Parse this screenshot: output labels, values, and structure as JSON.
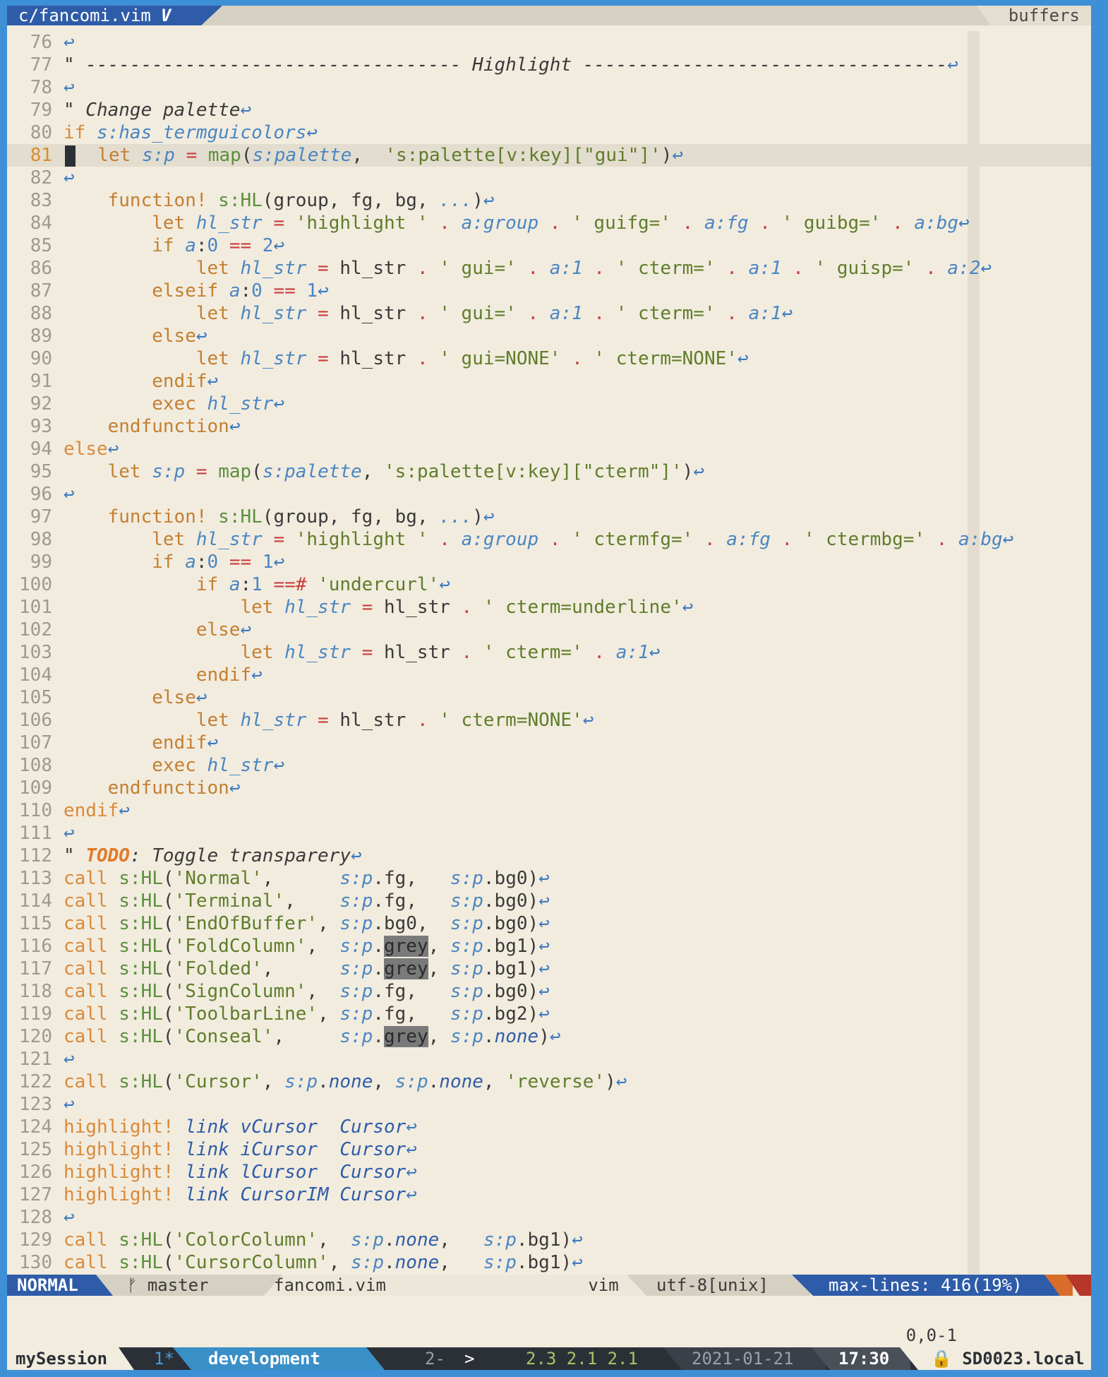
{
  "tabline": {
    "file_tab": "c/fancomi.vim",
    "file_tab_badge": "V",
    "buffers_label": "buffers"
  },
  "editor": {
    "lines": [
      {
        "n": "76",
        "h": "<span class='nl'>↩</span>"
      },
      {
        "n": "77",
        "h": "<span class='cm'>\" ---------------------------------- Highlight ---------------------------------</span><span class='nl'>↩</span>"
      },
      {
        "n": "78",
        "h": "<span class='nl'>↩</span>"
      },
      {
        "n": "79",
        "h": "<span class='cm'>\" Change palette</span><span class='nl'>↩</span>"
      },
      {
        "n": "80",
        "h": "<span class='kw'>if</span> <span class='var'>s:has_termguicolors</span><span class='nl'>↩</span>"
      },
      {
        "n": "81",
        "cur": true,
        "h": "<span class='cursorblk'></span>  <span class='kw2'>let</span> <span class='var'>s:p</span> <span class='op'>=</span> <span class='fn'>map</span>(<span class='var'>s:palette</span>,  <span class='str'>'s:palette[v:key][\"gui\"]'</span>)<span class='nl'>↩</span>"
      },
      {
        "n": "82",
        "h": "<span class='nl'>↩</span>"
      },
      {
        "n": "83",
        "h": "    <span class='kw2'>function!</span> <span class='fn'>s:HL</span>(group, fg, bg, <span class='var'>...</span>)<span class='nl'>↩</span>"
      },
      {
        "n": "84",
        "h": "        <span class='kw2'>let</span> <span class='var'>hl_str</span> <span class='op'>=</span> <span class='str'>'highlight '</span> <span class='op'>.</span> <span class='var'>a:group</span> <span class='op'>.</span> <span class='str'>' guifg='</span> <span class='op'>.</span> <span class='var'>a:fg</span> <span class='op'>.</span> <span class='str'>' guibg='</span> <span class='op'>.</span> <span class='var'>a:bg</span><span class='nl'>↩</span>"
      },
      {
        "n": "85",
        "h": "        <span class='kw2'>if</span> <span class='var'>a</span>:<span class='num'>0</span> <span class='op'>==</span> <span class='num'>2</span><span class='nl'>↩</span>"
      },
      {
        "n": "86",
        "h": "            <span class='kw2'>let</span> <span class='var'>hl_str</span> <span class='op'>=</span> hl_str <span class='op'>.</span> <span class='str'>' gui='</span> <span class='op'>.</span> <span class='var'>a:1</span> <span class='op'>.</span> <span class='str'>' cterm='</span> <span class='op'>.</span> <span class='var'>a:1</span> <span class='op'>.</span> <span class='str'>' guisp='</span> <span class='op'>.</span> <span class='var'>a:2</span><span class='nl'>↩</span>"
      },
      {
        "n": "87",
        "h": "        <span class='kw2'>elseif</span> <span class='var'>a</span>:<span class='num'>0</span> <span class='op'>==</span> <span class='num'>1</span><span class='nl'>↩</span>"
      },
      {
        "n": "88",
        "h": "            <span class='kw2'>let</span> <span class='var'>hl_str</span> <span class='op'>=</span> hl_str <span class='op'>.</span> <span class='str'>' gui='</span> <span class='op'>.</span> <span class='var'>a:1</span> <span class='op'>.</span> <span class='str'>' cterm='</span> <span class='op'>.</span> <span class='var'>a:1</span><span class='nl'>↩</span>"
      },
      {
        "n": "89",
        "h": "        <span class='kw2'>else</span><span class='nl'>↩</span>"
      },
      {
        "n": "90",
        "h": "            <span class='kw2'>let</span> <span class='var'>hl_str</span> <span class='op'>=</span> hl_str <span class='op'>.</span> <span class='str'>' gui=NONE'</span> <span class='op'>.</span> <span class='str'>' cterm=NONE'</span><span class='nl'>↩</span>"
      },
      {
        "n": "91",
        "h": "        <span class='kw2'>endif</span><span class='nl'>↩</span>"
      },
      {
        "n": "92",
        "h": "        <span class='kw2'>exec</span> <span class='var'>hl_str</span><span class='nl'>↩</span>"
      },
      {
        "n": "93",
        "h": "    <span class='kw2'>endfunction</span><span class='nl'>↩</span>"
      },
      {
        "n": "94",
        "h": "<span class='kw'>else</span><span class='nl'>↩</span>"
      },
      {
        "n": "95",
        "h": "    <span class='kw2'>let</span> <span class='var'>s:p</span> <span class='op'>=</span> <span class='fn'>map</span>(<span class='var'>s:palette</span>, <span class='str'>'s:palette[v:key][\"cterm\"]'</span>)<span class='nl'>↩</span>"
      },
      {
        "n": "96",
        "h": "<span class='nl'>↩</span>"
      },
      {
        "n": "97",
        "h": "    <span class='kw2'>function!</span> <span class='fn'>s:HL</span>(group, fg, bg, <span class='var'>...</span>)<span class='nl'>↩</span>"
      },
      {
        "n": "98",
        "h": "        <span class='kw2'>let</span> <span class='var'>hl_str</span> <span class='op'>=</span> <span class='str'>'highlight '</span> <span class='op'>.</span> <span class='var'>a:group</span> <span class='op'>.</span> <span class='str'>' ctermfg='</span> <span class='op'>.</span> <span class='var'>a:fg</span> <span class='op'>.</span> <span class='str'>' ctermbg='</span> <span class='op'>.</span> <span class='var'>a:bg</span><span class='nl'>↩</span>"
      },
      {
        "n": "99",
        "h": "        <span class='kw2'>if</span> <span class='var'>a</span>:<span class='num'>0</span> <span class='op'>==</span> <span class='num'>1</span><span class='nl'>↩</span>"
      },
      {
        "n": "100",
        "h": "            <span class='kw2'>if</span> <span class='var'>a</span>:<span class='num'>1</span> <span class='op'>==#</span> <span class='str'>'undercurl'</span><span class='nl'>↩</span>"
      },
      {
        "n": "101",
        "h": "                <span class='kw2'>let</span> <span class='var'>hl_str</span> <span class='op'>=</span> hl_str <span class='op'>.</span> <span class='str'>' cterm=underline'</span><span class='nl'>↩</span>"
      },
      {
        "n": "102",
        "h": "            <span class='kw2'>else</span><span class='nl'>↩</span>"
      },
      {
        "n": "103",
        "h": "                <span class='kw2'>let</span> <span class='var'>hl_str</span> <span class='op'>=</span> hl_str <span class='op'>.</span> <span class='str'>' cterm='</span> <span class='op'>.</span> <span class='var'>a:1</span><span class='nl'>↩</span>"
      },
      {
        "n": "104",
        "h": "            <span class='kw2'>endif</span><span class='nl'>↩</span>"
      },
      {
        "n": "105",
        "h": "        <span class='kw2'>else</span><span class='nl'>↩</span>"
      },
      {
        "n": "106",
        "h": "            <span class='kw2'>let</span> <span class='var'>hl_str</span> <span class='op'>=</span> hl_str <span class='op'>.</span> <span class='str'>' cterm=NONE'</span><span class='nl'>↩</span>"
      },
      {
        "n": "107",
        "h": "        <span class='kw2'>endif</span><span class='nl'>↩</span>"
      },
      {
        "n": "108",
        "h": "        <span class='kw2'>exec</span> <span class='var'>hl_str</span><span class='nl'>↩</span>"
      },
      {
        "n": "109",
        "h": "    <span class='kw2'>endfunction</span><span class='nl'>↩</span>"
      },
      {
        "n": "110",
        "h": "<span class='kw'>endif</span><span class='nl'>↩</span>"
      },
      {
        "n": "111",
        "h": "<span class='nl'>↩</span>"
      },
      {
        "n": "112",
        "h": "<span class='cm'>\" </span><span class='todo'>TODO</span><span class='cm'>: Toggle transparery</span><span class='nl'>↩</span>"
      },
      {
        "n": "113",
        "h": "<span class='kw'>call</span> <span class='fn'>s:HL</span>(<span class='str'>'Normal'</span>,      <span class='var'>s:p</span>.fg,   <span class='var'>s:p</span>.bg0)<span class='nl'>↩</span>"
      },
      {
        "n": "114",
        "h": "<span class='kw'>call</span> <span class='fn'>s:HL</span>(<span class='str'>'Terminal'</span>,    <span class='var'>s:p</span>.fg,   <span class='var'>s:p</span>.bg0)<span class='nl'>↩</span>"
      },
      {
        "n": "115",
        "h": "<span class='kw'>call</span> <span class='fn'>s:HL</span>(<span class='str'>'EndOfBuffer'</span>, <span class='var'>s:p</span>.bg0,  <span class='var'>s:p</span>.bg0)<span class='nl'>↩</span>"
      },
      {
        "n": "116",
        "h": "<span class='kw'>call</span> <span class='fn'>s:HL</span>(<span class='str'>'FoldColumn'</span>,  <span class='var'>s:p</span>.<span class='grey'>grey</span>, <span class='var'>s:p</span>.bg1)<span class='nl'>↩</span>"
      },
      {
        "n": "117",
        "h": "<span class='kw'>call</span> <span class='fn'>s:HL</span>(<span class='str'>'Folded'</span>,      <span class='var'>s:p</span>.<span class='grey'>grey</span>, <span class='var'>s:p</span>.bg1)<span class='nl'>↩</span>"
      },
      {
        "n": "118",
        "h": "<span class='kw'>call</span> <span class='fn'>s:HL</span>(<span class='str'>'SignColumn'</span>,  <span class='var'>s:p</span>.fg,   <span class='var'>s:p</span>.bg0)<span class='nl'>↩</span>"
      },
      {
        "n": "119",
        "h": "<span class='kw'>call</span> <span class='fn'>s:HL</span>(<span class='str'>'ToolbarLine'</span>, <span class='var'>s:p</span>.fg,   <span class='var'>s:p</span>.bg2)<span class='nl'>↩</span>"
      },
      {
        "n": "120",
        "h": "<span class='kw'>call</span> <span class='fn'>s:HL</span>(<span class='str'>'Conseal'</span>,     <span class='var'>s:p</span>.<span class='grey'>grey</span>, <span class='var'>s:p</span>.<span class='lnk'>none</span>)<span class='nl'>↩</span>"
      },
      {
        "n": "121",
        "h": "<span class='nl'>↩</span>"
      },
      {
        "n": "122",
        "h": "<span class='kw'>call</span> <span class='fn'>s:HL</span>(<span class='str'>'Cursor'</span>, <span class='var'>s:p</span>.<span class='lnk'>none</span>, <span class='var'>s:p</span>.<span class='lnk'>none</span>, <span class='str'>'reverse'</span>)<span class='nl'>↩</span>"
      },
      {
        "n": "123",
        "h": "<span class='nl'>↩</span>"
      },
      {
        "n": "124",
        "h": "<span class='kw'>highlight!</span> <span class='lnk'>link</span> <span class='lnk'>vCursor</span>  <span class='lnk'>Cursor</span><span class='nl'>↩</span>"
      },
      {
        "n": "125",
        "h": "<span class='kw'>highlight!</span> <span class='lnk'>link</span> <span class='lnk'>iCursor</span>  <span class='lnk'>Cursor</span><span class='nl'>↩</span>"
      },
      {
        "n": "126",
        "h": "<span class='kw'>highlight!</span> <span class='lnk'>link</span> <span class='lnk'>lCursor</span>  <span class='lnk'>Cursor</span><span class='nl'>↩</span>"
      },
      {
        "n": "127",
        "h": "<span class='kw'>highlight!</span> <span class='lnk'>link</span> <span class='lnk'>CursorIM</span> <span class='lnk'>Cursor</span><span class='nl'>↩</span>"
      },
      {
        "n": "128",
        "h": "<span class='nl'>↩</span>"
      },
      {
        "n": "129",
        "h": "<span class='kw'>call</span> <span class='fn'>s:HL</span>(<span class='str'>'ColorColumn'</span>,  <span class='var'>s:p</span>.<span class='lnk'>none</span>,   <span class='var'>s:p</span>.bg1)<span class='nl'>↩</span>"
      },
      {
        "n": "130",
        "h": "<span class='kw'>call</span> <span class='fn'>s:HL</span>(<span class='str'>'CursorColumn'</span>, <span class='var'>s:p</span>.<span class='lnk'>none</span>,   <span class='var'>s:p</span>.bg1)<span class='nl'>↩</span>"
      }
    ]
  },
  "statusline": {
    "mode": "NORMAL",
    "branch": "ᚠ master",
    "filename": "fancomi.vim",
    "filetype": "vim",
    "encoding": "utf-8[unix]",
    "position": "max-lines: 416(19%)"
  },
  "cmdline": {
    "ruler": "0,0-1"
  },
  "tmux": {
    "session": "mySession",
    "window1": "1*",
    "active_window": "development",
    "window2": "2-",
    "separator": ">",
    "load": "2.3 2.1 2.1",
    "date": "2021-01-21",
    "time": "17:30",
    "host": "🔒 SD0023.local"
  }
}
